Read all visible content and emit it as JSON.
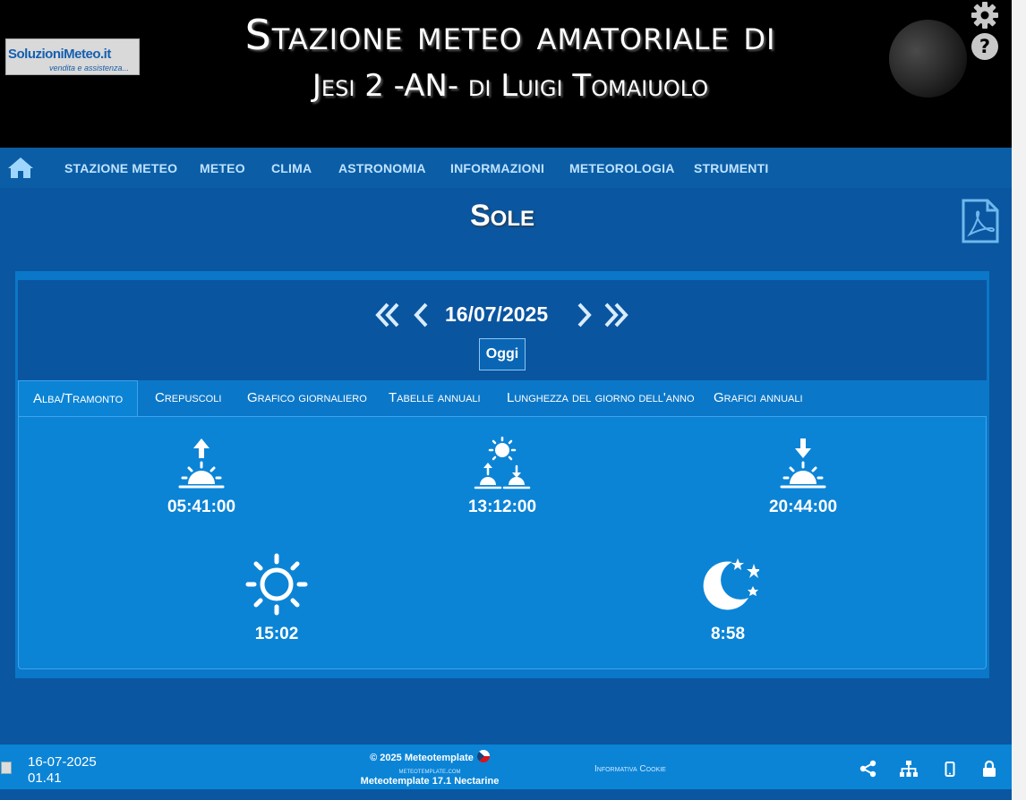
{
  "header": {
    "logo_text": "SoluzioniMeteo.it",
    "logo_subtext": "vendita e assistenza...",
    "title_line1": "Stazione meteo amatoriale di",
    "title_line2": "Jesi 2 -AN- di Luigi Tomaiuolo",
    "icons": [
      "gear-icon",
      "help-icon"
    ]
  },
  "nav": {
    "home_icon": "home-icon",
    "items": [
      "STAZIONE METEO",
      "METEO",
      "CLIMA",
      "ASTRONOMIA",
      "INFORMAZIONI",
      "METEOROLOGIA",
      "STRUMENTI"
    ]
  },
  "page": {
    "title": "Sole",
    "pdf_icon": "pdf-icon"
  },
  "date_nav": {
    "date": "16/07/2025",
    "today_label": "Oggi"
  },
  "tabs": [
    {
      "label": "Alba/Tramonto",
      "active": true
    },
    {
      "label": "Crepuscoli",
      "active": false
    },
    {
      "label": "Grafico giornaliero",
      "active": false
    },
    {
      "label": "Tabelle annuali",
      "active": false
    },
    {
      "label": "Lunghezza del giorno dell'anno",
      "active": false
    },
    {
      "label": "Grafici annuali",
      "active": false
    }
  ],
  "sun": {
    "sunrise": "05:41:00",
    "transit": "13:12:00",
    "sunset": "20:44:00",
    "day_length": "15:02",
    "night_length": "8:58"
  },
  "footer": {
    "date": "16-07-2025",
    "time": "01.41",
    "copyright": "© 2025  Meteotemplate",
    "site": "meteotemplate.com",
    "version": "Meteotemplate 17.1 Nectarine",
    "cookie": "Informativa Cookie",
    "icons": [
      "share-icon",
      "sitemap-icon",
      "mobile-icon",
      "lock-icon"
    ]
  },
  "colors": {
    "background": "#0a56a0",
    "nav": "#0b5ea6",
    "panel": "#0b84d6",
    "nav_text": "#bfe3ff"
  }
}
